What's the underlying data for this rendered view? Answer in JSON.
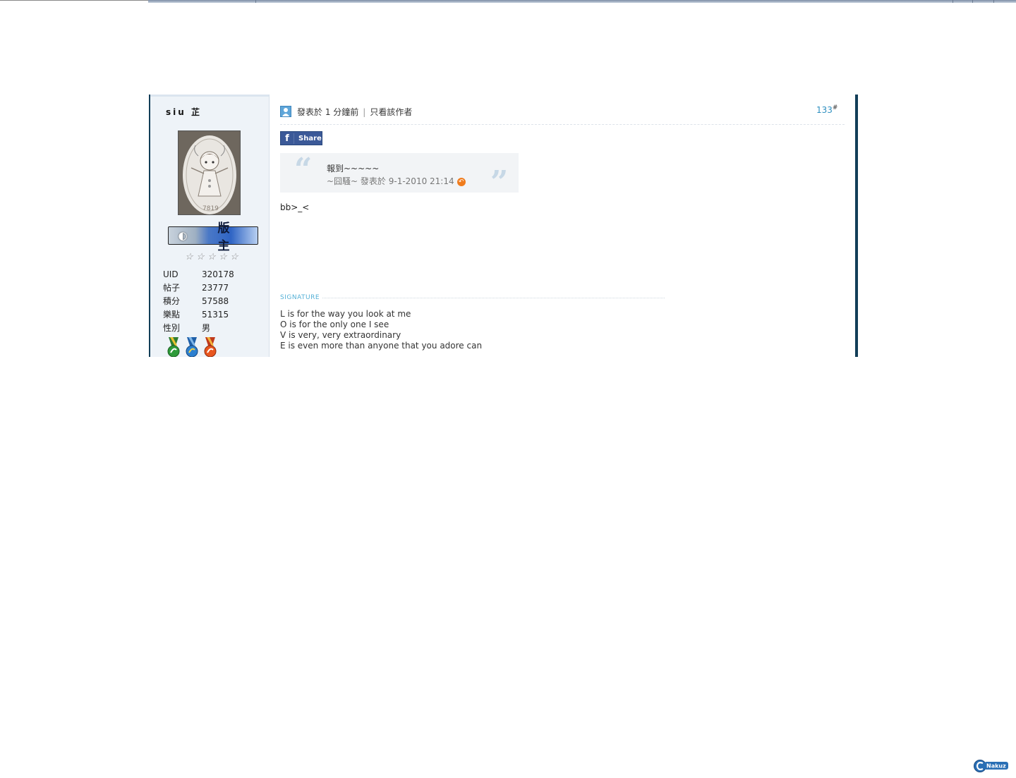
{
  "post": {
    "username": "siu 芷",
    "rank_title": "版 主",
    "stats": [
      {
        "label": "UID",
        "value": "320178"
      },
      {
        "label": "帖子",
        "value": "23777"
      },
      {
        "label": "積分",
        "value": "57588"
      },
      {
        "label": "樂點",
        "value": "51315"
      },
      {
        "label": "性別",
        "value": "男"
      }
    ],
    "header": {
      "posted_at": "發表於 1 分鐘前",
      "separator": "|",
      "only_author_link": "只看該作者",
      "floor_number": "133",
      "floor_suffix": "#"
    },
    "share": {
      "icon_letter": "f",
      "label": "Share"
    },
    "quote": {
      "text": "報到~~~~~",
      "attribution": "~囧騷~ 發表於 9-1-2010 21:14",
      "open_mark": "“",
      "close_mark": "”"
    },
    "message": "bb>_<",
    "signature": {
      "heading": "SIGNATURE",
      "lines": [
        "L is for the way you look at me",
        "O is for the only one I see",
        "V is very, very extraordinary",
        "E is even more than anyone that you adore can"
      ]
    }
  },
  "colors": {
    "accent_border": "#123e58",
    "link_blue": "#2e8fc0",
    "sidebar_bg": "#eef3f8",
    "facebook_blue": "#3b5998",
    "signature_label": "#54b0d6"
  },
  "icons": {
    "user": "user-icon",
    "goto": "arrow-goto-icon",
    "facebook": "facebook-icon",
    "stars": [
      "star-icon",
      "star-icon",
      "star-icon",
      "star-icon",
      "star-icon"
    ],
    "medals": [
      "medal-green-icon",
      "medal-blue-icon",
      "medal-orange-icon"
    ]
  }
}
